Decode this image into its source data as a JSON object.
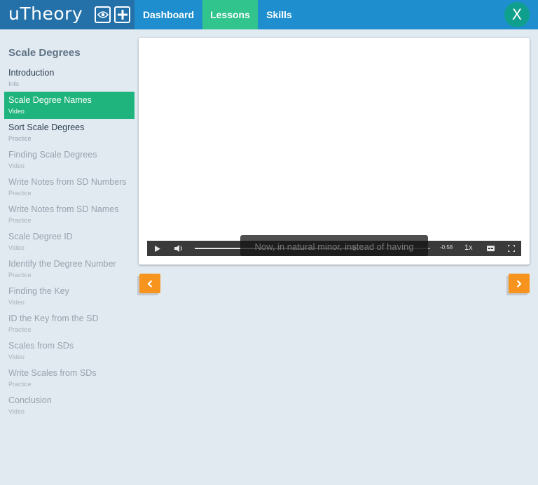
{
  "app": {
    "logo": "uTheory"
  },
  "nav": {
    "tabs": [
      "Dashboard",
      "Lessons",
      "Skills"
    ],
    "active_tab": "Lessons"
  },
  "user": {
    "avatar_initial": "X"
  },
  "sidebar": {
    "title": "Scale Degrees",
    "lessons": [
      {
        "name": "Introduction",
        "type": "Info",
        "status": "done"
      },
      {
        "name": "Scale Degree Names",
        "type": "Video",
        "status": "active"
      },
      {
        "name": "Sort Scale Degrees",
        "type": "Practice",
        "status": "done"
      },
      {
        "name": "Finding Scale Degrees",
        "type": "Video",
        "status": "todo"
      },
      {
        "name": "Write Notes from SD Numbers",
        "type": "Practice",
        "status": "todo"
      },
      {
        "name": "Write Notes from SD Names",
        "type": "Practice",
        "status": "todo"
      },
      {
        "name": "Scale Degree ID",
        "type": "Video",
        "status": "todo"
      },
      {
        "name": "Identify the Degree Number",
        "type": "Practice",
        "status": "todo"
      },
      {
        "name": "Finding the Key",
        "type": "Video",
        "status": "todo"
      },
      {
        "name": "ID the Key from the SD",
        "type": "Practice",
        "status": "todo"
      },
      {
        "name": "Scales from SDs",
        "type": "Video",
        "status": "todo"
      },
      {
        "name": "Write Scales from SDs",
        "type": "Practice",
        "status": "todo"
      },
      {
        "name": "Conclusion",
        "type": "Video",
        "status": "todo"
      }
    ]
  },
  "video": {
    "caption": "Now, in natural minor, instead of having",
    "time_remaining": "-0:58",
    "speed": "1x",
    "progress": 0.68
  },
  "colors": {
    "header": "#1f8ecf",
    "brand_block": "#2470a8",
    "active_tab": "#31c48d",
    "active_lesson": "#1fb47d",
    "avatar": "#0fa08d",
    "pager": "#f7941d"
  }
}
